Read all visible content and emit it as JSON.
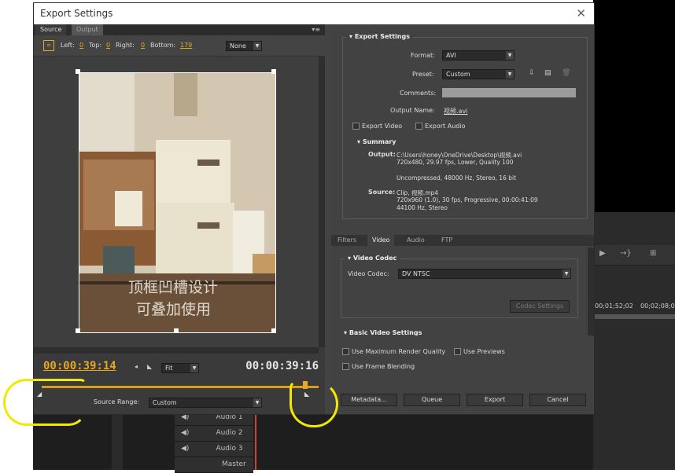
{
  "window": {
    "title": "Export Settings",
    "close_glyph": "✕"
  },
  "left": {
    "tabs": [
      "Source",
      "Output"
    ],
    "crop": {
      "left_label": "Left:",
      "left_value": "0",
      "top_label": "Top:",
      "top_value": "0",
      "right_label": "Right:",
      "right_value": "0",
      "bottom_label": "Bottom:",
      "bottom_value": "179",
      "ratio_value": "None"
    },
    "overlay_text_1": "顶框凹槽设计",
    "overlay_text_2": "可叠加使用",
    "current_time": "00:00:39:14",
    "zoom_value": "Fit",
    "duration_time": "00:00:39:16",
    "source_range_label": "Source Range:",
    "source_range_value": "Custom"
  },
  "export_settings": {
    "header": "Export Settings",
    "format_label": "Format:",
    "format_value": "AVI",
    "preset_label": "Preset:",
    "preset_value": "Custom",
    "comments_label": "Comments:",
    "output_name_label": "Output Name:",
    "output_name_value": "视频.avi",
    "export_video_label": "Export Video",
    "export_audio_label": "Export Audio",
    "summary_header": "Summary",
    "output_label": "Output:",
    "output_line1": "C:\\Users\\honey\\OneDrive\\Desktop\\视频.avi",
    "output_line2": "720x480, 29.97 fps, Lower, Quality 100",
    "output_line3": "Uncompressed, 48000 Hz, Stereo, 16 bit",
    "source_label": "Source:",
    "source_line1": "Clip, 视频.mp4",
    "source_line2": "720x960 (1.0), 30 fps, Progressive, 00:00:41:09",
    "source_line3": "44100 Hz, Stereo"
  },
  "sub_tabs": [
    "Filters",
    "Video",
    "Audio",
    "FTP"
  ],
  "video_codec": {
    "header": "Video Codec",
    "codec_label": "Video Codec:",
    "codec_value": "DV NTSC",
    "codec_settings_button": "Codec Settings"
  },
  "basic_video_header": "Basic Video Settings",
  "options": {
    "max_render_quality": "Use Maximum Render Quality",
    "use_previews": "Use Previews",
    "frame_blending": "Use Frame Blending"
  },
  "buttons": {
    "metadata": "Metadata...",
    "queue": "Queue",
    "export": "Export",
    "cancel": "Cancel"
  },
  "background": {
    "timecode_1": "00;01;52;02",
    "timecode_2": "00;02;08;0",
    "tracks": [
      "Audio 1",
      "Audio 2",
      "Audio 3",
      "Master"
    ]
  },
  "colors": {
    "accent_orange": "#e8a623",
    "annotation_yellow": "#f5e800",
    "dialog_bg": "#434343"
  }
}
